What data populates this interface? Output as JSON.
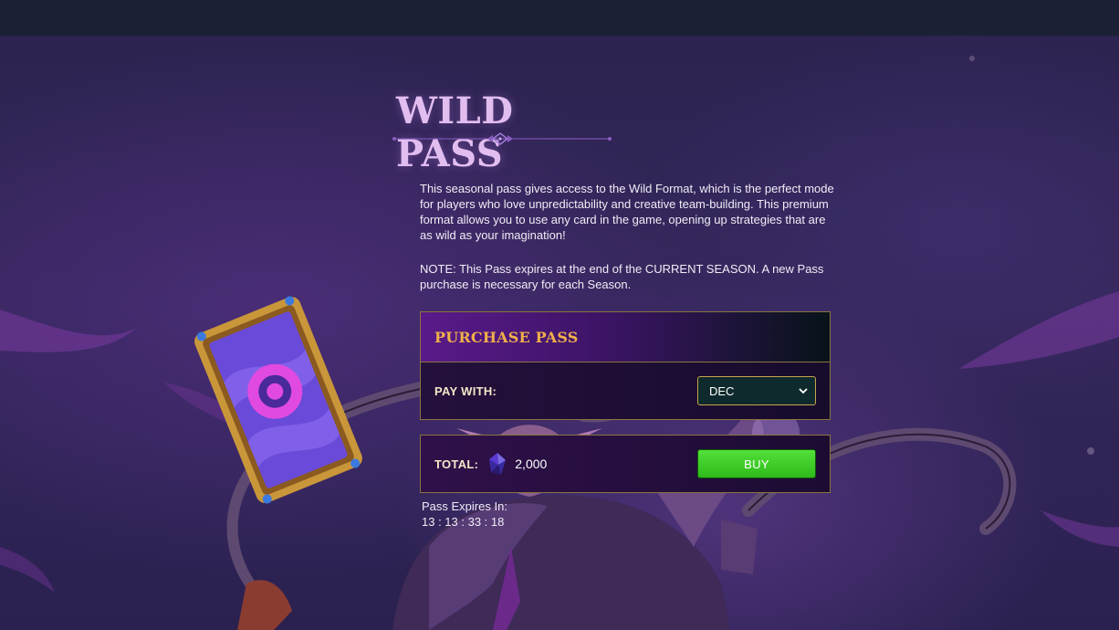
{
  "page": {
    "title": "WILD PASS",
    "description": "This seasonal pass gives access to the Wild Format, which is the perfect mode for players who love unpredictability and creative team-building. This premium format allows you to use any card in the game, opening up strategies that are as wild as your imagination!",
    "note": "NOTE: This Pass expires at the end of the CURRENT SEASON. A new Pass purchase is necessary for each Season."
  },
  "purchase": {
    "header": "PURCHASE PASS",
    "pay_with_label": "PAY WITH:",
    "currency_selected": "DEC",
    "total_label": "TOTAL:",
    "total_amount": "2,000",
    "buy_label": "BUY",
    "currency_icon": "dec-crystal-icon"
  },
  "expiry": {
    "label": "Pass Expires In:",
    "countdown": "13 : 13 : 33 : 18"
  },
  "colors": {
    "accent_gold": "#f0b04a",
    "title_lilac": "#e2bdf0",
    "buy_green": "#3ec826",
    "panel_border": "#8a7540"
  }
}
